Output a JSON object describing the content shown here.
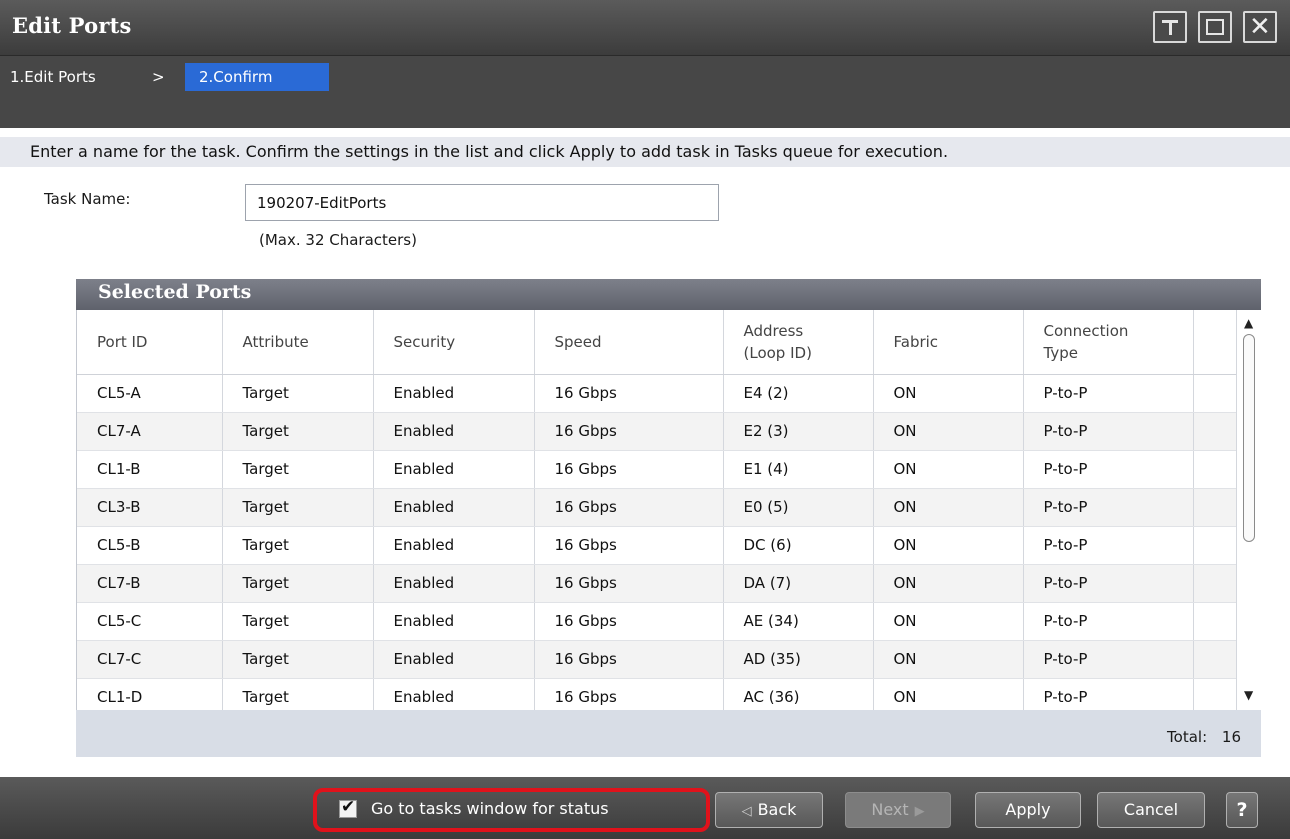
{
  "window": {
    "title": "Edit Ports",
    "pin_icon": "pin-icon",
    "maximize_icon": "maximize-icon",
    "close_icon": "close-icon",
    "close_glyph": "✕"
  },
  "steps": {
    "step1": "1.Edit Ports",
    "separator": ">",
    "step2": "2.Confirm"
  },
  "instruction": "Enter a name for the task. Confirm the settings in the list and click Apply to add task in Tasks queue for execution.",
  "task": {
    "label": "Task Name:",
    "value": "190207-EditPorts",
    "note": "(Max. 32 Characters)"
  },
  "table": {
    "title": "Selected Ports",
    "columns": [
      "Port ID",
      "Attribute",
      "Security",
      "Speed",
      "Address (Loop ID)",
      "Fabric",
      "Connection Type"
    ],
    "rows": [
      [
        "CL5-A",
        "Target",
        "Enabled",
        "16 Gbps",
        "E4 (2)",
        "ON",
        "P-to-P"
      ],
      [
        "CL7-A",
        "Target",
        "Enabled",
        "16 Gbps",
        "E2 (3)",
        "ON",
        "P-to-P"
      ],
      [
        "CL1-B",
        "Target",
        "Enabled",
        "16 Gbps",
        "E1 (4)",
        "ON",
        "P-to-P"
      ],
      [
        "CL3-B",
        "Target",
        "Enabled",
        "16 Gbps",
        "E0 (5)",
        "ON",
        "P-to-P"
      ],
      [
        "CL5-B",
        "Target",
        "Enabled",
        "16 Gbps",
        "DC (6)",
        "ON",
        "P-to-P"
      ],
      [
        "CL7-B",
        "Target",
        "Enabled",
        "16 Gbps",
        "DA (7)",
        "ON",
        "P-to-P"
      ],
      [
        "CL5-C",
        "Target",
        "Enabled",
        "16 Gbps",
        "AE (34)",
        "ON",
        "P-to-P"
      ],
      [
        "CL7-C",
        "Target",
        "Enabled",
        "16 Gbps",
        "AD (35)",
        "ON",
        "P-to-P"
      ],
      [
        "CL1-D",
        "Target",
        "Enabled",
        "16 Gbps",
        "AC (36)",
        "ON",
        "P-to-P"
      ]
    ],
    "total_label": "Total:",
    "total_value": "16"
  },
  "footer": {
    "goto_label": "Go to tasks window for status",
    "goto_checked": true,
    "back": "Back",
    "next": "Next",
    "apply": "Apply",
    "cancel": "Cancel",
    "help": "?"
  },
  "colors": {
    "highlight_border": "#e0121b",
    "step_active": "#2a6ad6"
  }
}
